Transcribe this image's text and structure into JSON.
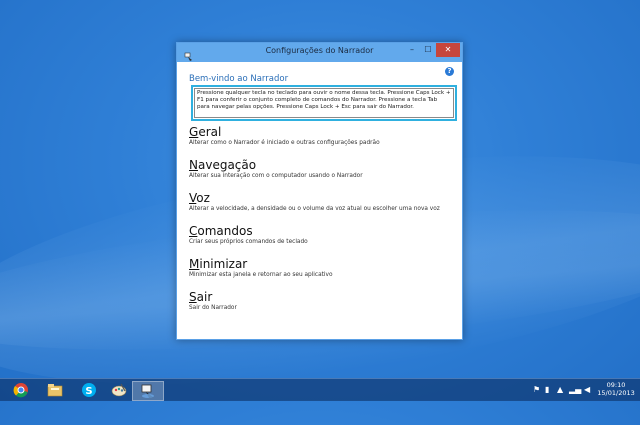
{
  "window": {
    "title": "Configurações do Narrador",
    "minimize_label": "–",
    "maximize_label": "☐",
    "close_label": "✕"
  },
  "welcome": {
    "heading": "Bem-vindo ao Narrador",
    "message": "Pressione qualquer tecla no teclado para ouvir o nome dessa tecla. Pressione Caps Lock + F1 para conferir o conjunto completo de comandos do Narrador. Pressione a tecla Tab para navegar pelas opções. Pressione Caps Lock + Esc para sair do Narrador."
  },
  "options": [
    {
      "key": "G",
      "rest": "eral",
      "desc": "Alterar como o Narrador é iniciado e outras configurações padrão"
    },
    {
      "key": "N",
      "rest": "avegação",
      "desc": "Alterar sua interação com o computador usando o Narrador"
    },
    {
      "key": "V",
      "rest": "oz",
      "desc": "Alterar a velocidade, a densidade ou o volume da voz atual ou escolher uma nova voz"
    },
    {
      "key": "C",
      "rest": "omandos",
      "desc": "Criar seus próprios comandos de teclado"
    },
    {
      "key": "M",
      "rest": "inimizar",
      "desc": "Minimizar esta janela e retornar ao seu aplicativo"
    },
    {
      "key": "S",
      "rest": "air",
      "desc": "Sair do Narrador"
    }
  ],
  "taskbar": {
    "icons": [
      "chrome-icon",
      "file-explorer-icon",
      "skype-icon",
      "paint-icon",
      "narrator-icon"
    ]
  },
  "clock": {
    "time": "09:10",
    "date": "15/01/2013"
  },
  "colors": {
    "accent": "#2fb0df",
    "titlebar": "#62a9ec",
    "close": "#c7463c",
    "link": "#2b6fb8"
  }
}
